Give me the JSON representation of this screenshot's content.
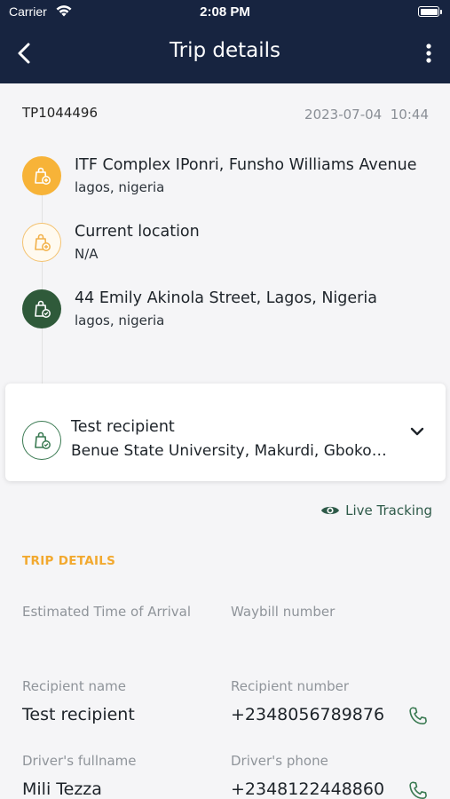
{
  "status_bar": {
    "carrier": "Carrier",
    "time": "2:08 PM"
  },
  "nav": {
    "title": "Trip details"
  },
  "trip": {
    "id": "TP1044496",
    "date": "2023-07-04",
    "time": "10:44"
  },
  "stops": [
    {
      "title": "ITF Complex IPonri, Funsho Williams Avenue",
      "subtitle": "lagos, nigeria",
      "icon": "package-pickup-icon"
    },
    {
      "title": "Current location",
      "subtitle": "N/A",
      "icon": "package-current-icon"
    },
    {
      "title": "44 Emily Akinola Street, Lagos, Nigeria",
      "subtitle": "lagos, nigeria",
      "icon": "package-delivered-icon"
    }
  ],
  "recipient_card": {
    "name": "Test recipient",
    "address": "Benue State University, Makurdi, Gboko Road"
  },
  "live_tracking": {
    "label": "Live Tracking"
  },
  "trip_details": {
    "section_title": "TRIP DETAILS",
    "eta_label": "Estimated Time of Arrival",
    "eta_value": "",
    "waybill_label": "Waybill number",
    "waybill_value": "",
    "recipient_name_label": "Recipient name",
    "recipient_name_value": "Test recipient",
    "recipient_number_label": "Recipient number",
    "recipient_number_value": "+2348056789876",
    "driver_name_label": "Driver's fullname",
    "driver_name_value": "Mili Tezza",
    "driver_phone_label": "Driver's phone",
    "driver_phone_value": "+2348122448860"
  },
  "colors": {
    "header_bg": "#172440",
    "accent_orange": "#f7b338",
    "accent_green": "#2f5a3a",
    "section_title": "#f2a92f"
  }
}
